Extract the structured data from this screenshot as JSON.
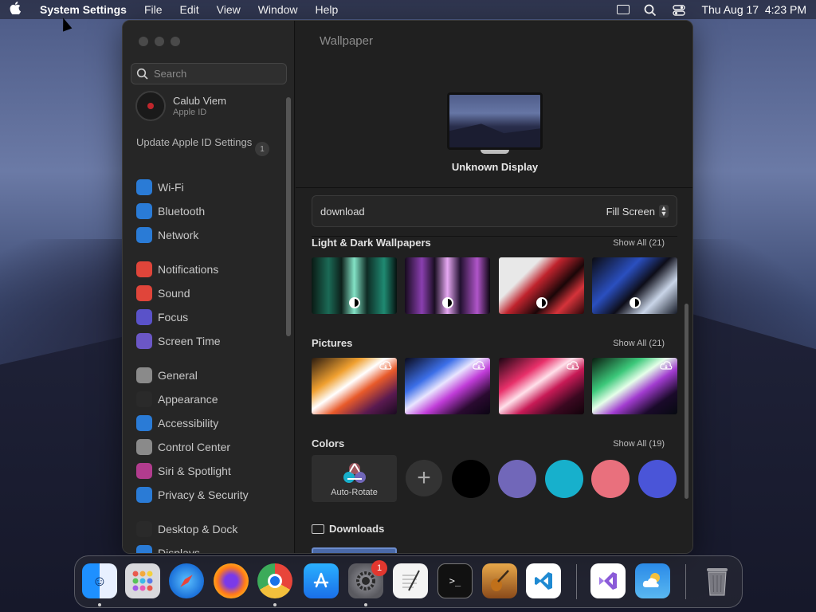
{
  "menubar": {
    "app_name": "System Settings",
    "menus": [
      "File",
      "Edit",
      "View",
      "Window",
      "Help"
    ],
    "datetime": "Thu Aug 17  4:23 PM"
  },
  "sidebar": {
    "search_placeholder": "Search",
    "user_name": "Calub Viem",
    "user_sub": "Apple ID",
    "update_text": "Update Apple ID Settings",
    "update_badge": "1",
    "items": [
      {
        "label": "Wi-Fi",
        "icon": "wifi-icon",
        "color": "#2a7bd6"
      },
      {
        "label": "Bluetooth",
        "icon": "bluetooth-icon",
        "color": "#2a7bd6"
      },
      {
        "label": "Network",
        "icon": "globe-icon",
        "color": "#2a7bd6"
      },
      {
        "label": "Notifications",
        "icon": "bell-icon",
        "color": "#e0453a"
      },
      {
        "label": "Sound",
        "icon": "speaker-icon",
        "color": "#e0453a"
      },
      {
        "label": "Focus",
        "icon": "moon-icon",
        "color": "#5a52c9"
      },
      {
        "label": "Screen Time",
        "icon": "hourglass-icon",
        "color": "#6b57c6"
      },
      {
        "label": "General",
        "icon": "gear-icon",
        "color": "#8a8a8a"
      },
      {
        "label": "Appearance",
        "icon": "appearance-icon",
        "color": "#2a2a2a"
      },
      {
        "label": "Accessibility",
        "icon": "accessibility-icon",
        "color": "#2a7bd6"
      },
      {
        "label": "Control Center",
        "icon": "control-center-icon",
        "color": "#8a8a8a"
      },
      {
        "label": "Siri & Spotlight",
        "icon": "siri-icon",
        "color": "#b23c8e"
      },
      {
        "label": "Privacy & Security",
        "icon": "hand-icon",
        "color": "#2a7bd6"
      },
      {
        "label": "Desktop & Dock",
        "icon": "desktop-icon",
        "color": "#2a2a2a"
      },
      {
        "label": "Displays",
        "icon": "display-icon",
        "color": "#2a7bd6"
      }
    ]
  },
  "main": {
    "title": "Wallpaper",
    "display_name": "Unknown Display",
    "wallpaper_name": "download",
    "fill_mode": "Fill Screen",
    "sections": {
      "light_dark": {
        "title": "Light & Dark Wallpapers",
        "show_all": "Show All (21)"
      },
      "pictures": {
        "title": "Pictures",
        "show_all": "Show All (21)"
      },
      "colors": {
        "title": "Colors",
        "show_all": "Show All (19)"
      }
    },
    "auto_rotate": "Auto-Rotate",
    "swatches": [
      "#000000",
      "#7167b9",
      "#17b0cc",
      "#e9707d",
      "#4a55d8"
    ],
    "downloads": "Downloads"
  },
  "dock": {
    "badge": "1",
    "apps": [
      "Finder",
      "Launchpad",
      "Safari",
      "Firefox",
      "Chrome",
      "App Store",
      "System Settings",
      "TextEdit",
      "Terminal",
      "Instruments",
      "VS Code",
      "Visual Studio",
      "Weather",
      "Trash"
    ]
  }
}
